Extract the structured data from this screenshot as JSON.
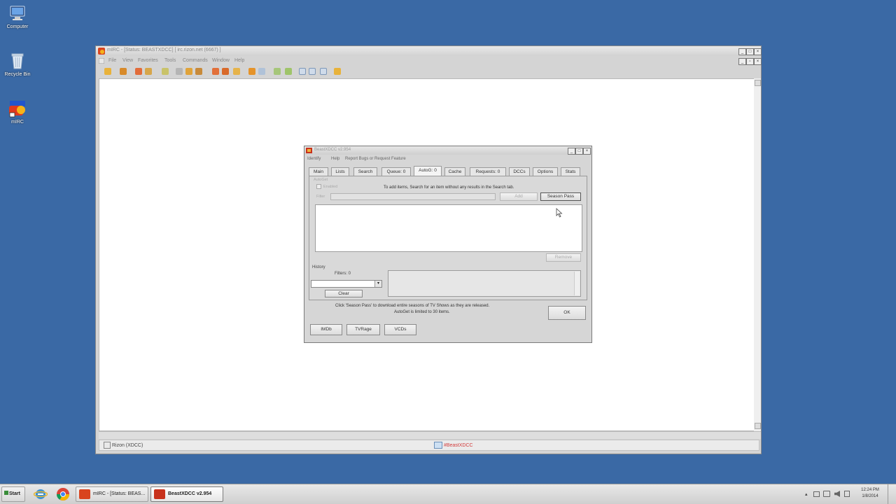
{
  "desktop": {
    "icons": [
      {
        "label": "Computer",
        "icon": "computer-icon"
      },
      {
        "label": "Recycle Bin",
        "icon": "recycle-bin-icon"
      },
      {
        "label": "mIRC",
        "icon": "mirc-icon"
      }
    ]
  },
  "mirc": {
    "title": "mIRC - [Status: BEASTXDCC] [ irc.rizon.net (6667) ]",
    "menu": [
      "File",
      "View",
      "Favorites",
      "Tools",
      "Commands",
      "Window",
      "Help"
    ],
    "switchbar": {
      "status_item": "Rizon (XDCC)",
      "channel_item": "#BeastXDCC"
    }
  },
  "dialog": {
    "title": "BeastXDCC v2.954",
    "menu": [
      "Identify",
      "Help",
      "Report Bugs or Request Feature"
    ],
    "tabs": [
      "Main",
      "Lists",
      "Search",
      "Queue: 0",
      "AutoG: 0",
      "Cache",
      "Requests: 0",
      "DCCs",
      "Options",
      "Stats"
    ],
    "active_tab_index": 4,
    "autoget": {
      "group_label": "AutoGet",
      "enabled_label": "Enabled",
      "info_text": "To add items, Search for an item without any results in the Search tab.",
      "filter_label": "Filter",
      "add_button": "Add",
      "season_pass_button": "Season Pass",
      "remove_button": "Remove"
    },
    "history": {
      "label": "History",
      "filters_label": "Filters: 0",
      "clear_button": "Clear"
    },
    "footer": {
      "info_line1": "Click 'Season Pass' to download entire seasons of TV Shows as they are released.",
      "info_line2": "AutoGet is limited to 30 items.",
      "ok_button": "OK"
    },
    "bottom_buttons": [
      "IMDb",
      "TVRage",
      "VCDs"
    ]
  },
  "taskbar": {
    "start_label": "Start",
    "tasks": [
      {
        "label": "mIRC - [Status: BEAS...",
        "active": false
      },
      {
        "label": "BeastXDCC v2.954",
        "active": true
      }
    ],
    "clock_time": "12:24 PM",
    "clock_date": "1/8/2014"
  },
  "colors": {
    "desktop": "#3a69a5",
    "dialog_bg": "#d6d6d6",
    "channel_link": "#d23c3c"
  }
}
